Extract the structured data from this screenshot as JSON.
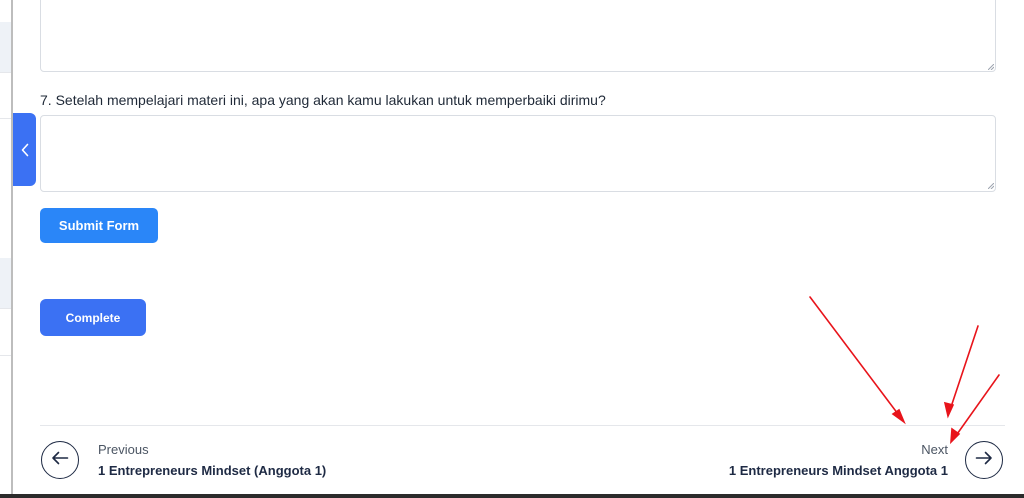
{
  "form": {
    "question_7": "7. Setelah mempelajari materi ini, apa yang akan kamu lakukan untuk memperbaiki dirimu?",
    "answer_6_value": "",
    "answer_7_value": "",
    "submit_label": "Submit Form"
  },
  "lesson": {
    "complete_label": "Complete"
  },
  "navigation": {
    "previous": {
      "caption": "Previous",
      "title": "1 Entrepreneurs Mindset (Anggota 1)"
    },
    "next": {
      "caption": "Next",
      "title": "1 Entrepreneurs Mindset Anggota 1"
    }
  },
  "colors": {
    "primary_button": "#3b71f3",
    "submit_button": "#2a86f8",
    "nav_icon": "#1e2a44",
    "annotation_arrow": "#e8141b"
  },
  "icons": {
    "collapse_tab": "chevron-left-icon",
    "previous": "arrow-left-icon",
    "next": "arrow-right-icon"
  }
}
